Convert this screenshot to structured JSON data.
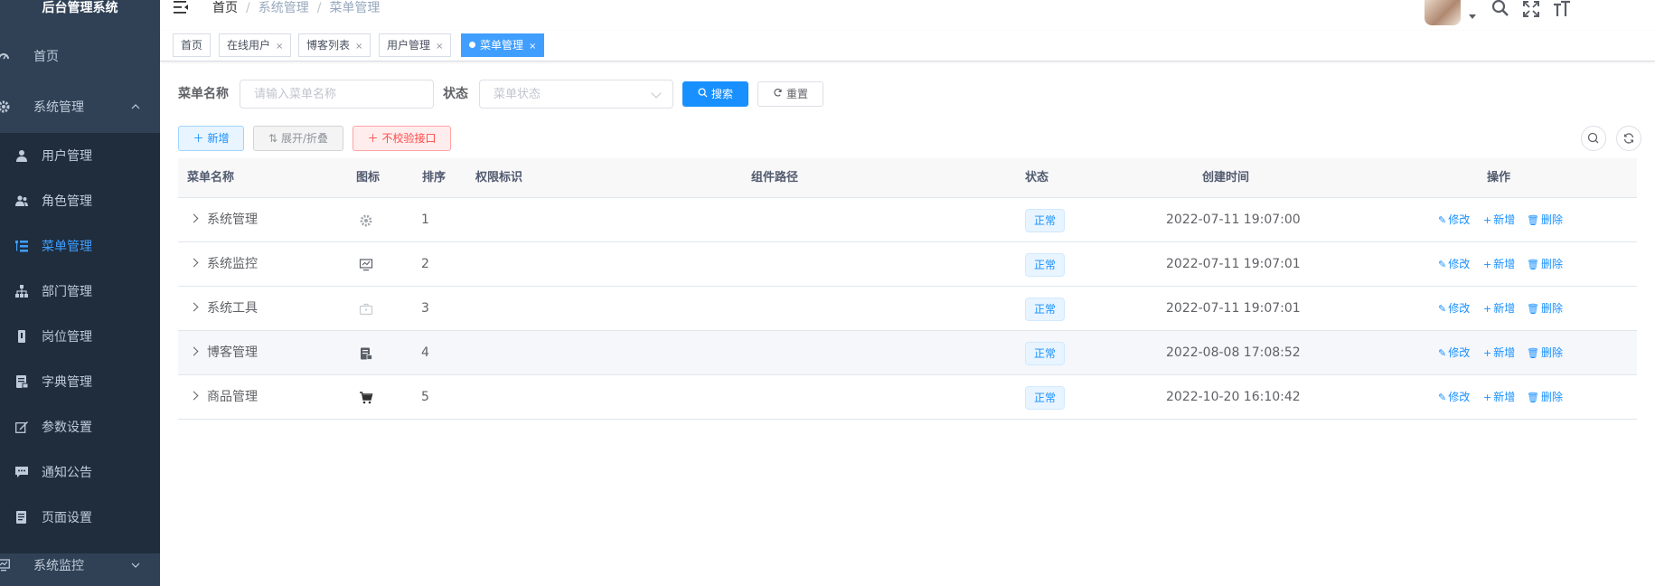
{
  "sidebar": {
    "title": "后台管理系统",
    "home": "首页",
    "system": "系统管理",
    "items": [
      {
        "label": "用户管理",
        "icon": "user-icon"
      },
      {
        "label": "角色管理",
        "icon": "peoples-icon"
      },
      {
        "label": "菜单管理",
        "icon": "tree-table-icon"
      },
      {
        "label": "部门管理",
        "icon": "tree-icon"
      },
      {
        "label": "岗位管理",
        "icon": "post-icon"
      },
      {
        "label": "字典管理",
        "icon": "dict-icon"
      },
      {
        "label": "参数设置",
        "icon": "edit-icon"
      },
      {
        "label": "通知公告",
        "icon": "message-icon"
      },
      {
        "label": "页面设置",
        "icon": "documentation-icon"
      }
    ],
    "monitor": "系统监控",
    "active_color": "#409eff",
    "bg_color": "#304156"
  },
  "navbar": {
    "breadcrumb": [
      "首页",
      "系统管理",
      "菜单管理"
    ]
  },
  "tags": [
    {
      "label": "首页"
    },
    {
      "label": "在线用户",
      "close": "×"
    },
    {
      "label": "博客列表",
      "close": "×"
    },
    {
      "label": "用户管理",
      "close": "×"
    },
    {
      "label": "菜单管理",
      "close": "×",
      "active": true
    }
  ],
  "search": {
    "name_label": "菜单名称",
    "name_placeholder": "请输入菜单名称",
    "status_label": "状态",
    "status_placeholder": "菜单状态",
    "search_btn": "搜索",
    "reset_btn": "重置"
  },
  "toolbar": {
    "add_btn": "新增",
    "expand_btn": "展开/折叠",
    "nocheck_btn": "不校验接口"
  },
  "table": {
    "headers": [
      "菜单名称",
      "图标",
      "排序",
      "权限标识",
      "组件路径",
      "状态",
      "创建时间",
      "操作"
    ],
    "rows": [
      {
        "name": "系统管理",
        "icon": "system-icon",
        "order": "1",
        "perms": "",
        "component": "",
        "status": "正常",
        "created": "2022-07-11 19:07:00"
      },
      {
        "name": "系统监控",
        "icon": "monitor-icon",
        "order": "2",
        "perms": "",
        "component": "",
        "status": "正常",
        "created": "2022-07-11 19:07:01"
      },
      {
        "name": "系统工具",
        "icon": "tool-icon",
        "order": "3",
        "perms": "",
        "component": "",
        "status": "正常",
        "created": "2022-07-11 19:07:01"
      },
      {
        "name": "博客管理",
        "icon": "blog-icon",
        "order": "4",
        "perms": "",
        "component": "",
        "status": "正常",
        "created": "2022-08-08 17:08:52"
      },
      {
        "name": "商品管理",
        "icon": "shopping-icon",
        "order": "5",
        "perms": "",
        "component": "",
        "status": "正常",
        "created": "2022-10-20 16:10:42"
      }
    ],
    "ops": {
      "edit": "修改",
      "add": "新增",
      "delete": "删除"
    }
  }
}
